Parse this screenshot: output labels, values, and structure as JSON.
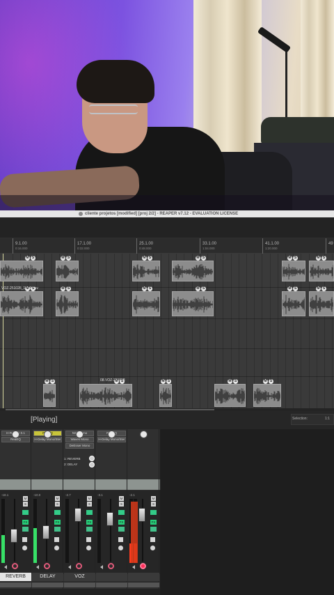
{
  "window": {
    "title": "cliente projetos [modified] [proj 2/2] - REAPER v7.12 - EVALUATION LICENSE"
  },
  "ruler": {
    "markers": [
      {
        "bar": "9.1.00",
        "time": "0:16.000"
      },
      {
        "bar": "17.1.00",
        "time": "0:32.000"
      },
      {
        "bar": "25.1.00",
        "time": "0:48.000"
      },
      {
        "bar": "33.1.00",
        "time": "1:04.000"
      },
      {
        "bar": "41.1.00",
        "time": "1:20.000"
      },
      {
        "bar": "49",
        "time": ""
      }
    ]
  },
  "arrange": {
    "item_label": "VOZ-251028_1824.wav",
    "item_label_2": "08.VOZ-251028"
  },
  "transport": {
    "status": "[Playing]",
    "selection_label": "Selection:",
    "selection_value": "1:1"
  },
  "mixer": {
    "strips": [
      {
        "name": "REVERB",
        "fx": [
          "H-Reverb 0.1",
          "ReaEQ"
        ],
        "volume": "-18.1",
        "selected": true
      },
      {
        "name": "DELAY",
        "fx": [
          "ReaEQ",
          "H-Delay Mono/Ster"
        ],
        "volume": "-10.0",
        "selected": false
      },
      {
        "name": "VOZ",
        "fx": [
          "NS1 Mono",
          "Waves Mono",
          "DeEsser Mono"
        ],
        "volume": "-2.7",
        "selected": false
      },
      {
        "name": "",
        "fx": [
          "ReaEQ",
          "H-Delay Mono/Ster"
        ],
        "volume": "-3.1",
        "selected": false
      },
      {
        "name": "",
        "fx": [],
        "volume": "-2.1",
        "selected": false
      }
    ],
    "sends": [
      "1: REVERB",
      "2: DELAY"
    ]
  },
  "colors": {
    "accent_yellow": "#c8c43a",
    "meter_green": "#37e067",
    "meter_red": "#ff3b1f",
    "fx_green": "#26d07a",
    "rec_arm": "#ff2e5a"
  }
}
